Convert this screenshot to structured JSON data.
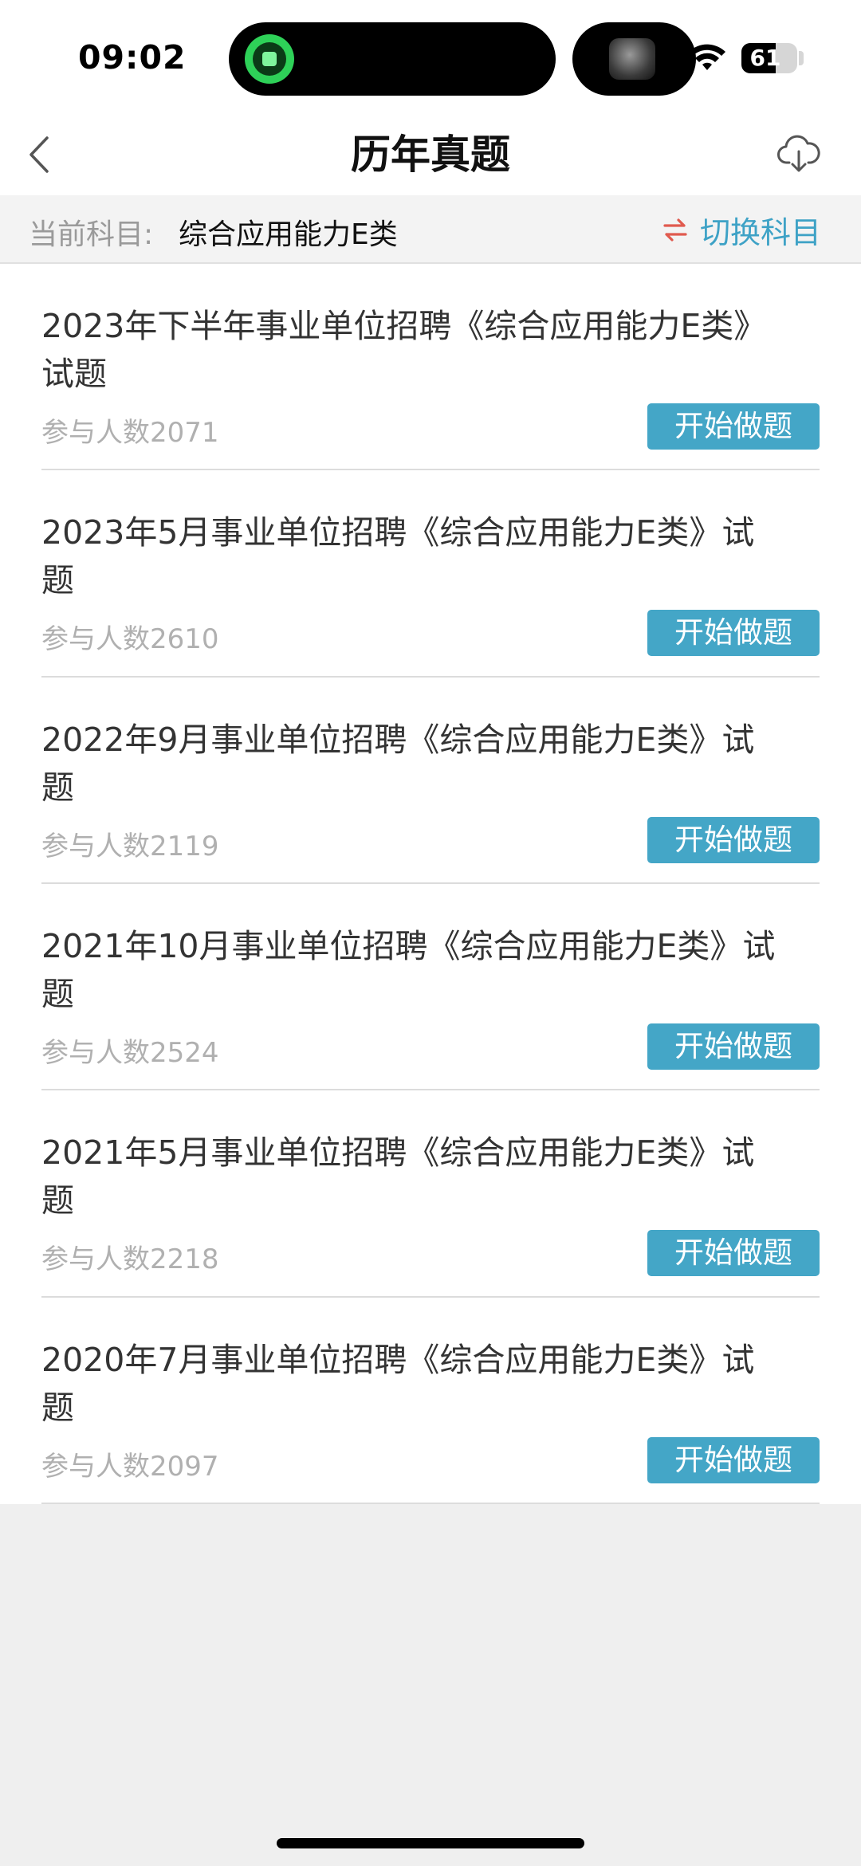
{
  "status_bar": {
    "time": "09:02",
    "battery_text": "61",
    "battery_level": 0.61,
    "icons": [
      "recording-app-icon",
      "wifi-icon",
      "battery-icon"
    ]
  },
  "nav": {
    "title": "历年真题",
    "back_icon": "chevron-left-icon",
    "download_icon": "cloud-download-icon"
  },
  "subject_bar": {
    "label": "当前科目:",
    "value": "综合应用能力E类",
    "switch_label": "切换科目",
    "switch_icon": "swap-arrows-icon"
  },
  "exams": [
    {
      "title": "2023年下半年事业单位招聘《综合应用能力E类》试题",
      "count": "参与人数2071",
      "action": "开始做题"
    },
    {
      "title": "2023年5月事业单位招聘《综合应用能力E类》试题",
      "count": "参与人数2610",
      "action": "开始做题"
    },
    {
      "title": "2022年9月事业单位招聘《综合应用能力E类》试题",
      "count": "参与人数2119",
      "action": "开始做题"
    },
    {
      "title": "2021年10月事业单位招聘《综合应用能力E类》试题",
      "count": "参与人数2524",
      "action": "开始做题"
    },
    {
      "title": "2021年5月事业单位招聘《综合应用能力E类》试题",
      "count": "参与人数2218",
      "action": "开始做题"
    },
    {
      "title": "2020年7月事业单位招聘《综合应用能力E类》试题",
      "count": "参与人数2097",
      "action": "开始做题"
    }
  ],
  "colors": {
    "accent": "#44a6c7",
    "switch_icon": "#e05a4e",
    "background": "#efefef"
  }
}
